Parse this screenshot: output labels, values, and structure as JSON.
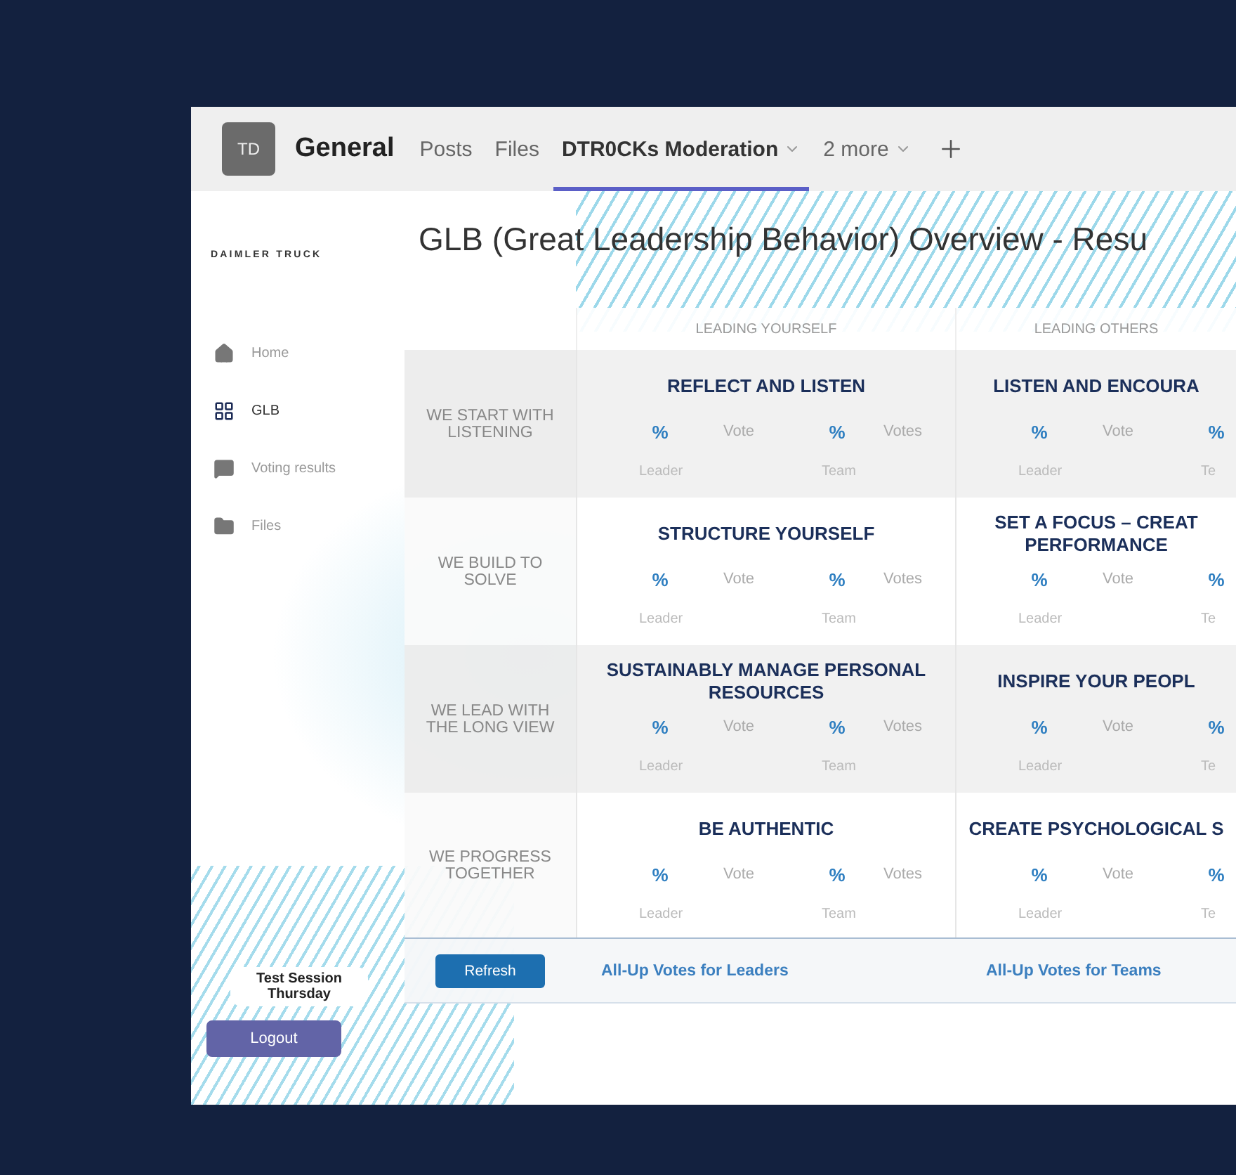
{
  "header": {
    "avatar": "TD",
    "title": "General",
    "tabs": [
      {
        "label": "Posts",
        "selected": false,
        "dropdown": false
      },
      {
        "label": "Files",
        "selected": false,
        "dropdown": false
      },
      {
        "label": "DTR0CKs Moderation",
        "selected": true,
        "dropdown": true
      },
      {
        "label": "2 more",
        "selected": false,
        "dropdown": true
      }
    ]
  },
  "sidebar": {
    "logo": "DAIMLER TRUCK",
    "items": [
      {
        "label": "Home",
        "kind": "home",
        "selected": false
      },
      {
        "label": "GLB",
        "kind": "grid",
        "selected": true
      },
      {
        "label": "Voting results",
        "kind": "board",
        "selected": false
      },
      {
        "label": "Files",
        "kind": "folder",
        "selected": false
      }
    ],
    "session": "Test Session Thursday",
    "logout": "Logout"
  },
  "page": {
    "title": "GLB (Great Leadership Behavior) Overview - Resu",
    "columns": [
      "LEADING YOURSELF",
      "LEADING OTHERS"
    ],
    "rows": [
      {
        "label": "WE START WITH LISTENING",
        "cells": [
          {
            "title": "REFLECT AND LISTEN",
            "leader_percent": "%",
            "leader_votes": "Vote",
            "leader_label": "Leader",
            "team_percent": "%",
            "team_votes": "Votes",
            "team_label": "Team"
          },
          {
            "title": "LISTEN AND ENCOURA",
            "leader_percent": "%",
            "leader_votes": "Vote",
            "leader_label": "Leader",
            "team_percent": "%",
            "team_label": "Te"
          }
        ]
      },
      {
        "label": "WE BUILD TO SOLVE",
        "cells": [
          {
            "title": "STRUCTURE YOURSELF",
            "leader_percent": "%",
            "leader_votes": "Vote",
            "leader_label": "Leader",
            "team_percent": "%",
            "team_votes": "Votes",
            "team_label": "Team"
          },
          {
            "title": "SET A FOCUS – CREAT PERFORMANCE",
            "leader_percent": "%",
            "leader_votes": "Vote",
            "leader_label": "Leader",
            "team_percent": "%",
            "team_label": "Te"
          }
        ]
      },
      {
        "label": "WE LEAD WITH THE LONG VIEW",
        "cells": [
          {
            "title": "SUSTAINABLY MANAGE PERSONAL RESOURCES",
            "leader_percent": "%",
            "leader_votes": "Vote",
            "leader_label": "Leader",
            "team_percent": "%",
            "team_votes": "Votes",
            "team_label": "Team"
          },
          {
            "title": "INSPIRE YOUR PEOPL",
            "leader_percent": "%",
            "leader_votes": "Vote",
            "leader_label": "Leader",
            "team_percent": "%",
            "team_label": "Te"
          }
        ]
      },
      {
        "label": "WE PROGRESS TOGETHER",
        "cells": [
          {
            "title": "BE AUTHENTIC",
            "leader_percent": "%",
            "leader_votes": "Vote",
            "leader_label": "Leader",
            "team_percent": "%",
            "team_votes": "Votes",
            "team_label": "Team"
          },
          {
            "title": "CREATE PSYCHOLOGICAL S",
            "leader_percent": "%",
            "leader_votes": "Vote",
            "leader_label": "Leader",
            "team_percent": "%",
            "team_label": "Te"
          }
        ]
      }
    ],
    "refresh": "Refresh",
    "links": [
      "All-Up Votes for Leaders",
      "All-Up Votes for Teams"
    ]
  }
}
